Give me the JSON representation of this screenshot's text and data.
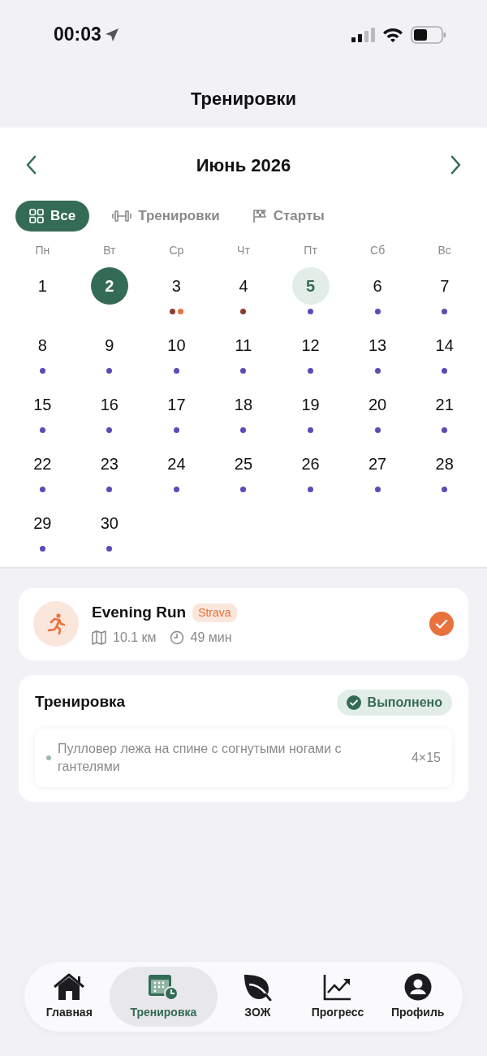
{
  "status_bar": {
    "time": "00:03"
  },
  "title": "Тренировки",
  "calendar": {
    "month": "Июнь 2026",
    "filters": [
      {
        "label": "Все",
        "kind": "all",
        "selected": true
      },
      {
        "label": "Тренировки",
        "kind": "workouts",
        "selected": false
      },
      {
        "label": "Старты",
        "kind": "races",
        "selected": false
      }
    ],
    "weekdays": [
      "Пн",
      "Вт",
      "Ср",
      "Чт",
      "Пт",
      "Сб",
      "Вс"
    ],
    "days": [
      {
        "day": "1",
        "selected": false,
        "highlighted": false
      },
      {
        "day": "2",
        "selected": true,
        "highlighted": false
      },
      {
        "day": "3",
        "selected": false,
        "highlighted": false,
        "dots": [
          {
            "color": "#8e3b2e"
          },
          {
            "color": "#e8713c"
          }
        ]
      },
      {
        "day": "4",
        "selected": false,
        "highlighted": false,
        "dots": [
          {
            "color": "#8e3b2e"
          }
        ]
      },
      {
        "day": "5",
        "selected": false,
        "highlighted": true,
        "dots": [
          {
            "color": "#5b4bb7"
          }
        ]
      },
      {
        "day": "6",
        "selected": false,
        "highlighted": false,
        "dots": [
          {
            "color": "#5b4bb7"
          }
        ]
      },
      {
        "day": "7",
        "selected": false,
        "highlighted": false,
        "dots": [
          {
            "color": "#5b4bb7"
          }
        ]
      },
      {
        "day": "8",
        "selected": false,
        "highlighted": false,
        "dots": [
          {
            "color": "#5b4bb7"
          }
        ]
      },
      {
        "day": "9",
        "selected": false,
        "highlighted": false,
        "dots": [
          {
            "color": "#5b4bb7"
          }
        ]
      },
      {
        "day": "10",
        "selected": false,
        "highlighted": false,
        "dots": [
          {
            "color": "#5b4bb7"
          }
        ]
      },
      {
        "day": "11",
        "selected": false,
        "highlighted": false,
        "dots": [
          {
            "color": "#5b4bb7"
          }
        ]
      },
      {
        "day": "12",
        "selected": false,
        "highlighted": false,
        "dots": [
          {
            "color": "#5b4bb7"
          }
        ]
      },
      {
        "day": "13",
        "selected": false,
        "highlighted": false,
        "dots": [
          {
            "color": "#5b4bb7"
          }
        ]
      },
      {
        "day": "14",
        "selected": false,
        "highlighted": false,
        "dots": [
          {
            "color": "#5b4bb7"
          }
        ]
      },
      {
        "day": "15",
        "selected": false,
        "highlighted": false,
        "dots": [
          {
            "color": "#5b4bb7"
          }
        ]
      },
      {
        "day": "16",
        "selected": false,
        "highlighted": false,
        "dots": [
          {
            "color": "#5b4bb7"
          }
        ]
      },
      {
        "day": "17",
        "selected": false,
        "highlighted": false,
        "dots": [
          {
            "color": "#5b4bb7"
          }
        ]
      },
      {
        "day": "18",
        "selected": false,
        "highlighted": false,
        "dots": [
          {
            "color": "#5b4bb7"
          }
        ]
      },
      {
        "day": "19",
        "selected": false,
        "highlighted": false,
        "dots": [
          {
            "color": "#5b4bb7"
          }
        ]
      },
      {
        "day": "20",
        "selected": false,
        "highlighted": false,
        "dots": [
          {
            "color": "#5b4bb7"
          }
        ]
      },
      {
        "day": "21",
        "selected": false,
        "highlighted": false,
        "dots": [
          {
            "color": "#5b4bb7"
          }
        ]
      },
      {
        "day": "22",
        "selected": false,
        "highlighted": false,
        "dots": [
          {
            "color": "#5b4bb7"
          }
        ]
      },
      {
        "day": "23",
        "selected": false,
        "highlighted": false,
        "dots": [
          {
            "color": "#5b4bb7"
          }
        ]
      },
      {
        "day": "24",
        "selected": false,
        "highlighted": false,
        "dots": [
          {
            "color": "#5b4bb7"
          }
        ]
      },
      {
        "day": "25",
        "selected": false,
        "highlighted": false,
        "dots": [
          {
            "color": "#5b4bb7"
          }
        ]
      },
      {
        "day": "26",
        "selected": false,
        "highlighted": false,
        "dots": [
          {
            "color": "#5b4bb7"
          }
        ]
      },
      {
        "day": "27",
        "selected": false,
        "highlighted": false,
        "dots": [
          {
            "color": "#5b4bb7"
          }
        ]
      },
      {
        "day": "28",
        "selected": false,
        "highlighted": false,
        "dots": [
          {
            "color": "#5b4bb7"
          }
        ]
      },
      {
        "day": "29",
        "selected": false,
        "highlighted": false,
        "dots": [
          {
            "color": "#5b4bb7"
          }
        ]
      },
      {
        "day": "30",
        "selected": false,
        "highlighted": false,
        "dots": [
          {
            "color": "#5b4bb7"
          }
        ]
      }
    ]
  },
  "activity": {
    "title": "Evening Run",
    "source": "Strava",
    "distance": "10.1 км",
    "duration": "49 мин",
    "done": true
  },
  "training": {
    "title": "Тренировка",
    "status": "Выполнено",
    "exercises": [
      {
        "name": "Пулловер лежа на спине с согнутыми ногами с гантелями",
        "sets": "4×15"
      }
    ]
  },
  "tab_bar": [
    {
      "label": "Главная",
      "kind": "home",
      "selected": false
    },
    {
      "label": "Тренировка",
      "kind": "calendar",
      "selected": true
    },
    {
      "label": "ЗОЖ",
      "kind": "leaf",
      "selected": false
    },
    {
      "label": "Прогресс",
      "kind": "chart",
      "selected": false
    },
    {
      "label": "Профиль",
      "kind": "profile",
      "selected": false
    }
  ]
}
